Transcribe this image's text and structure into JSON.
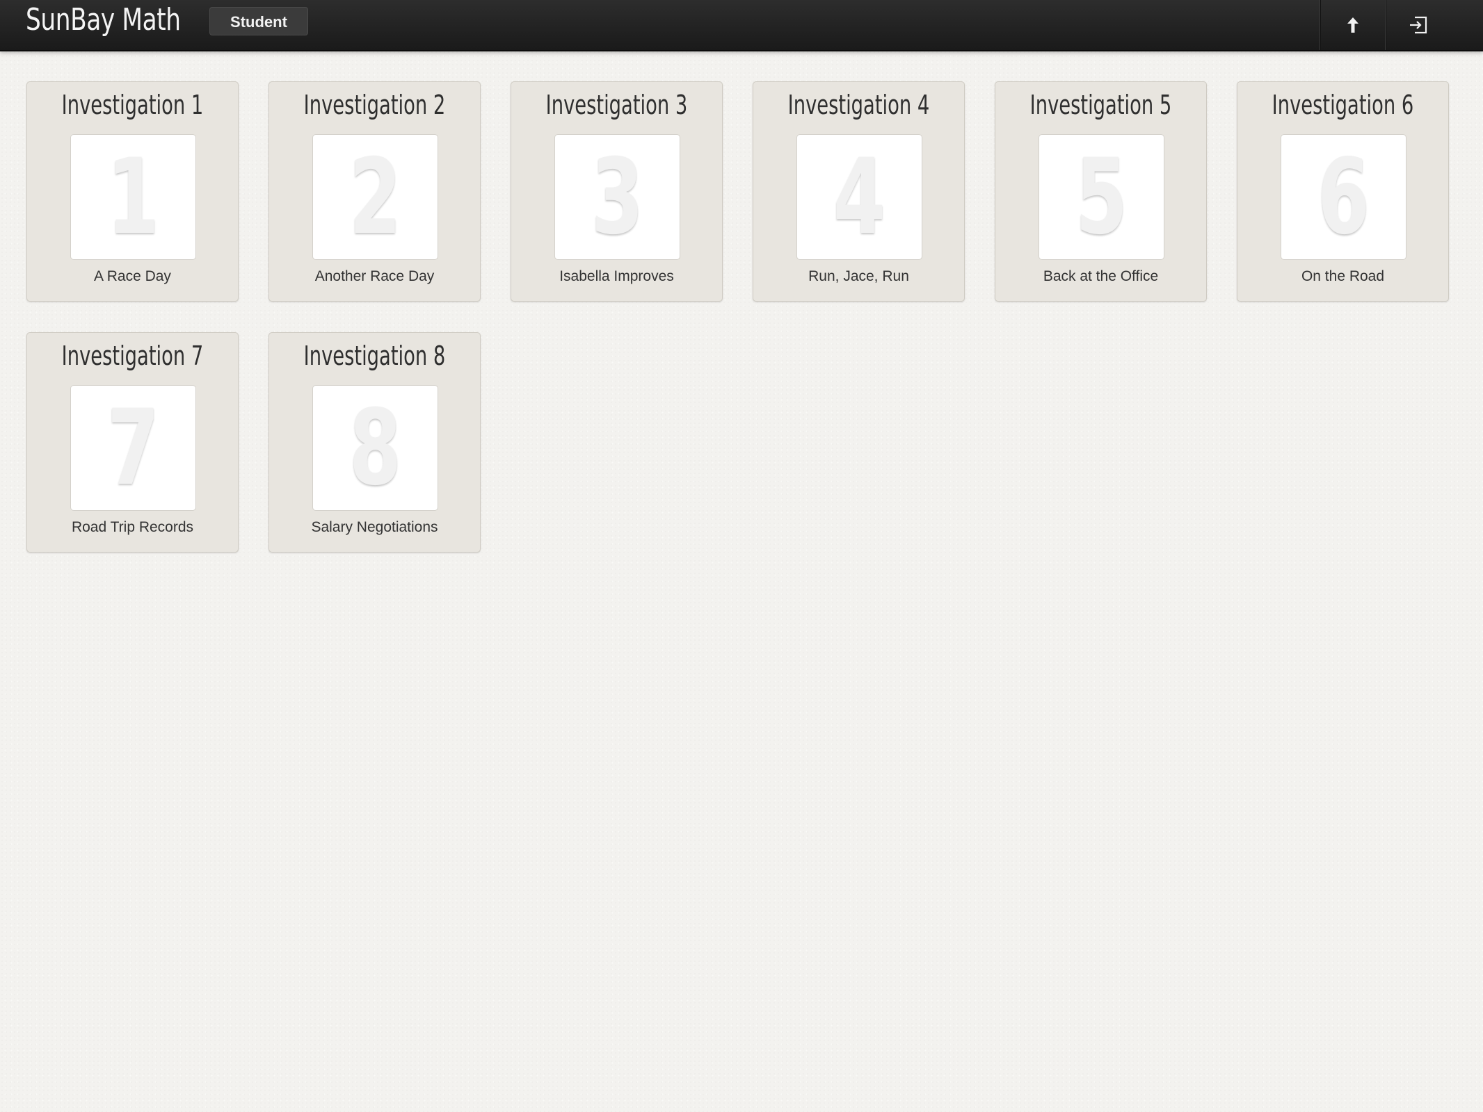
{
  "header": {
    "app_title": "SunBay Math",
    "role_label": "Student",
    "up_icon": "arrow-up-icon",
    "logout_icon": "logout-icon"
  },
  "investigations": [
    {
      "title": "Investigation 1",
      "number": "1",
      "subtitle": "A Race Day"
    },
    {
      "title": "Investigation 2",
      "number": "2",
      "subtitle": "Another Race Day"
    },
    {
      "title": "Investigation 3",
      "number": "3",
      "subtitle": "Isabella Improves"
    },
    {
      "title": "Investigation 4",
      "number": "4",
      "subtitle": "Run, Jace, Run"
    },
    {
      "title": "Investigation 5",
      "number": "5",
      "subtitle": "Back at the Office"
    },
    {
      "title": "Investigation 6",
      "number": "6",
      "subtitle": "On the Road"
    },
    {
      "title": "Investigation 7",
      "number": "7",
      "subtitle": "Road Trip Records"
    },
    {
      "title": "Investigation 8",
      "number": "8",
      "subtitle": "Salary Negotiations"
    }
  ],
  "colors": {
    "topbar": "#1f1f1f",
    "background": "#f3f2ef",
    "card": "#e8e5df"
  }
}
